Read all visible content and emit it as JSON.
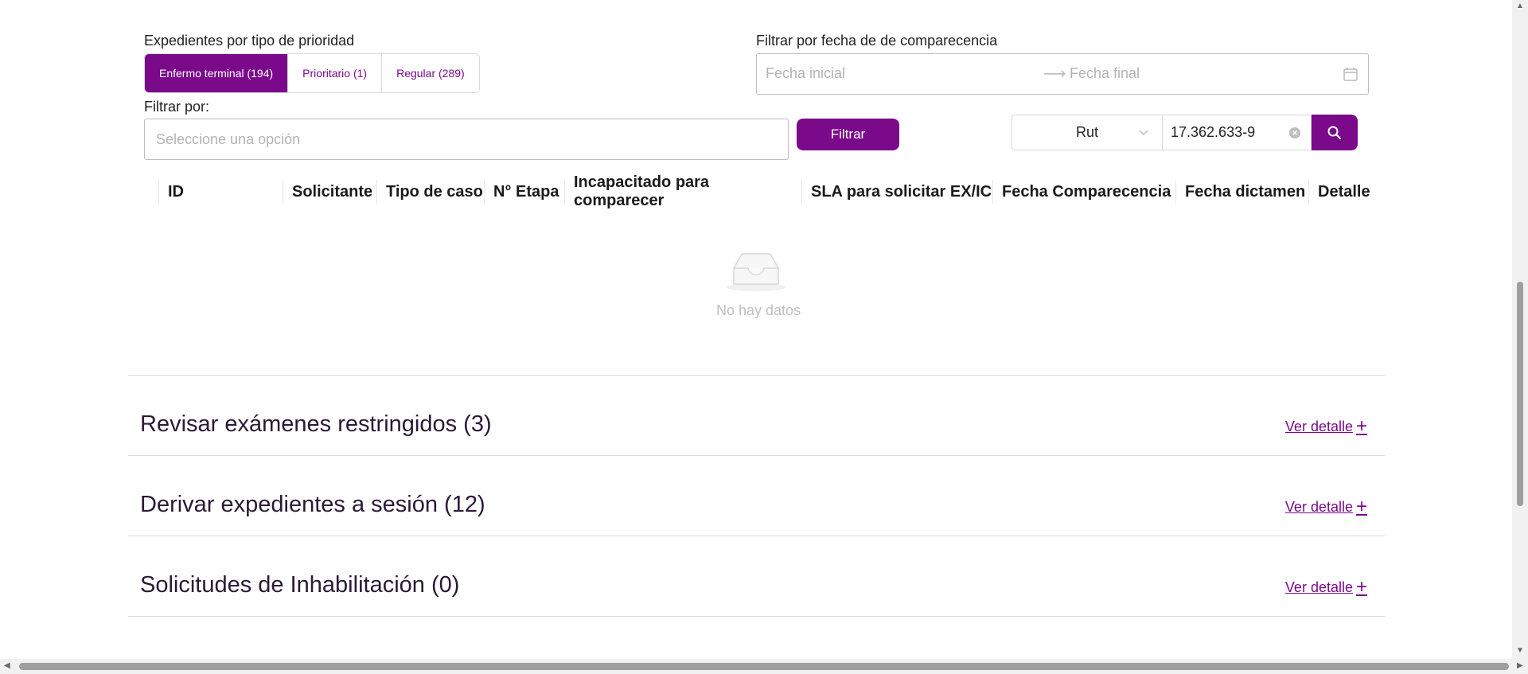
{
  "priority": {
    "label": "Expedientes por tipo de prioridad",
    "buttons": [
      {
        "label": "Enfermo terminal (194)",
        "active": true
      },
      {
        "label": "Prioritario (1)",
        "active": false
      },
      {
        "label": "Regular (289)",
        "active": false
      }
    ]
  },
  "date_filter": {
    "label": "Filtrar por fecha de de comparecencia",
    "start_placeholder": "Fecha inicial",
    "end_placeholder": "Fecha final"
  },
  "filter_by": {
    "label": "Filtrar por:",
    "placeholder": "Seleccione una opción",
    "button": "Filtrar"
  },
  "search": {
    "type_value": "Rut",
    "input_value": "17.362.633-9"
  },
  "table": {
    "columns": [
      "ID",
      "Solicitante",
      "Tipo de caso",
      "N° Etapa",
      "Incapacitado para comparecer",
      "SLA para solicitar EX/IC",
      "Fecha Comparecencia",
      "Fecha dictamen",
      "Detalle"
    ],
    "empty_text": "No hay datos"
  },
  "sections": [
    {
      "title": "Revisar exámenes restringidos (3)",
      "link": "Ver detalle"
    },
    {
      "title": "Derivar expedientes a sesión (12)",
      "link": "Ver detalle"
    },
    {
      "title": "Solicitudes de Inhabilitación (0)",
      "link": "Ver detalle"
    }
  ],
  "colors": {
    "accent": "#7a0a8a"
  }
}
